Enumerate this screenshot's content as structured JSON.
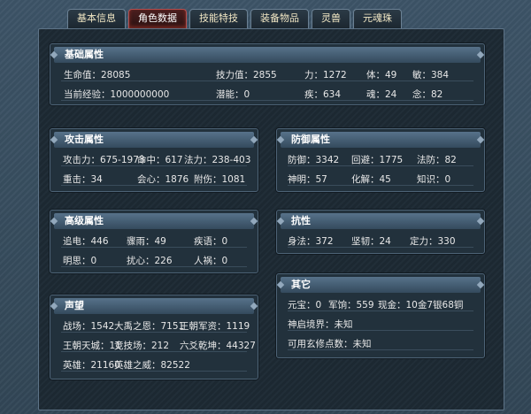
{
  "tabs": [
    {
      "label": "基本信息",
      "active": false
    },
    {
      "label": "角色数据",
      "active": true
    },
    {
      "label": "技能特技",
      "active": false
    },
    {
      "label": "装备物品",
      "active": false
    },
    {
      "label": "灵兽",
      "active": false
    },
    {
      "label": "元魂珠",
      "active": false
    }
  ],
  "basic": {
    "title": "基础属性",
    "hp": "生命值：28085",
    "mp": "技力值：2855",
    "str": "力：1272",
    "con": "体：49",
    "agi": "敏：384",
    "exp": "当前经验：1000000000",
    "potential": "潜能：0",
    "spd": "疾：634",
    "soul": "魂：24",
    "mind": "念：82"
  },
  "attack": {
    "title": "攻击属性",
    "atk": "攻击力：675-1973",
    "hit": "命中：617",
    "magic": "法力：238-403",
    "crit": "重击：34",
    "heart": "会心：1876",
    "pierce": "附伤：1081"
  },
  "defense": {
    "title": "防御属性",
    "def": "防御：3342",
    "dodge": "回避：1775",
    "mdef": "法防：82",
    "sense": "神明：57",
    "resolve": "化解：45",
    "knowledge": "知识：0"
  },
  "advanced": {
    "title": "高级属性",
    "chase": "追电：446",
    "fear": "骤雨：49",
    "swift": "疾语：0",
    "clear": "明思：0",
    "disturb": "扰心：226",
    "human": "人祸：0"
  },
  "resist": {
    "title": "抗性",
    "body": "身法：372",
    "tough": "坚韧：24",
    "stable": "定力：330"
  },
  "reputation": {
    "title": "声望",
    "battle": "战场：1542",
    "grace": "大禹之恩：7151",
    "royal": "王朝军资：1119",
    "king": "王朝天城：11",
    "arena": "竞技场：212",
    "six": "六爻乾坤：44327",
    "hero": "英雄：21160",
    "heroa": "英雄之威：82522"
  },
  "other": {
    "title": "其它",
    "yuanbao": "元宝：0",
    "army": "军饷：559",
    "cash": "现金：10金7银68铜",
    "realm": "神启境界：未知",
    "points": "可用玄修点数：未知"
  }
}
